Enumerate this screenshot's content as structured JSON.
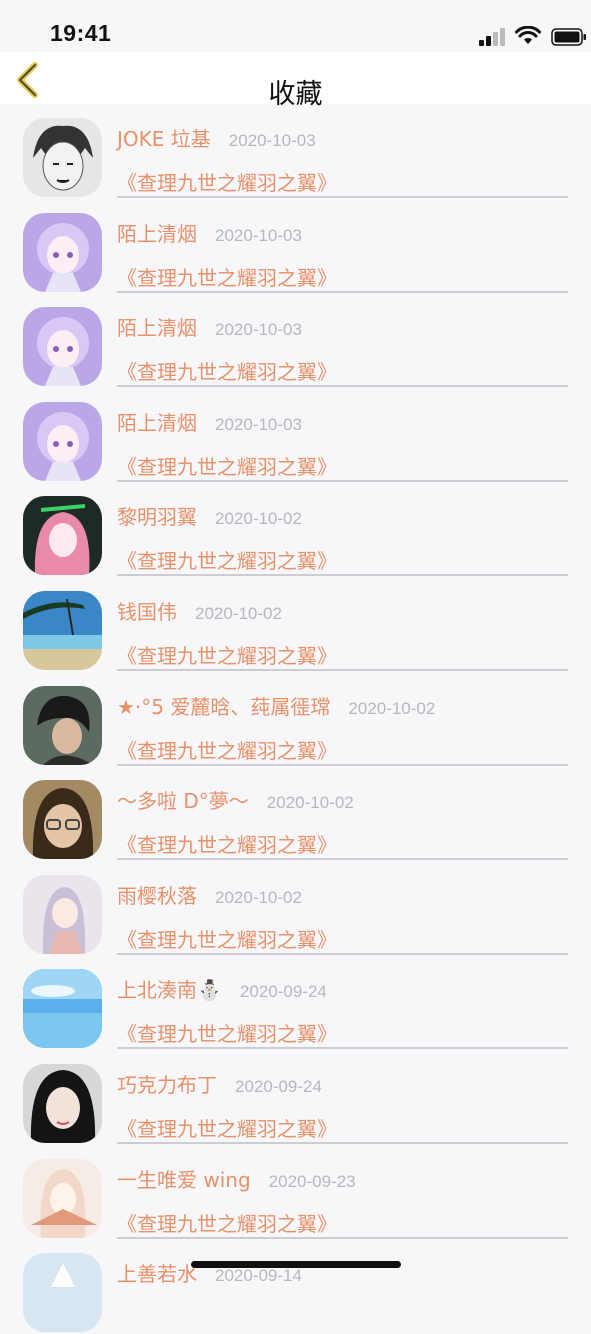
{
  "status": {
    "time": "19:41"
  },
  "nav": {
    "title": "收藏"
  },
  "items": [
    {
      "name": "JOKE 垃基",
      "date": "2020-10-03",
      "title": "《查理九世之耀羽之翼》"
    },
    {
      "name": "陌上清烟",
      "date": "2020-10-03",
      "title": "《查理九世之耀羽之翼》"
    },
    {
      "name": "陌上清烟",
      "date": "2020-10-03",
      "title": "《查理九世之耀羽之翼》"
    },
    {
      "name": "陌上清烟",
      "date": "2020-10-03",
      "title": "《查理九世之耀羽之翼》"
    },
    {
      "name": "黎明羽翼",
      "date": "2020-10-02",
      "title": "《查理九世之耀羽之翼》"
    },
    {
      "name": "钱国伟",
      "date": "2020-10-02",
      "title": "《查理九世之耀羽之翼》"
    },
    {
      "name": "★·°5 爱麓晗、莼属徰瑺",
      "date": "2020-10-02",
      "title": "《查理九世之耀羽之翼》"
    },
    {
      "name": "～多啦 D°夢～",
      "date": "2020-10-02",
      "title": "《查理九世之耀羽之翼》"
    },
    {
      "name": "雨樱秋落",
      "date": "2020-10-02",
      "title": "《查理九世之耀羽之翼》"
    },
    {
      "name": "上北湊南⛄",
      "date": "2020-09-24",
      "title": "《查理九世之耀羽之翼》"
    },
    {
      "name": "巧克力布丁",
      "date": "2020-09-24",
      "title": "《查理九世之耀羽之翼》"
    },
    {
      "name": "一生唯爱 wing",
      "date": "2020-09-23",
      "title": "《查理九世之耀羽之翼》"
    },
    {
      "name": "上善若水",
      "date": "2020-09-14",
      "title": ""
    }
  ],
  "colors": {
    "accent": "#e8926a",
    "date": "#b8b8bc",
    "back_arrow": "#e6c84a"
  },
  "icons": [
    "back-chevron-icon",
    "signal-icon",
    "wifi-icon",
    "battery-icon"
  ]
}
